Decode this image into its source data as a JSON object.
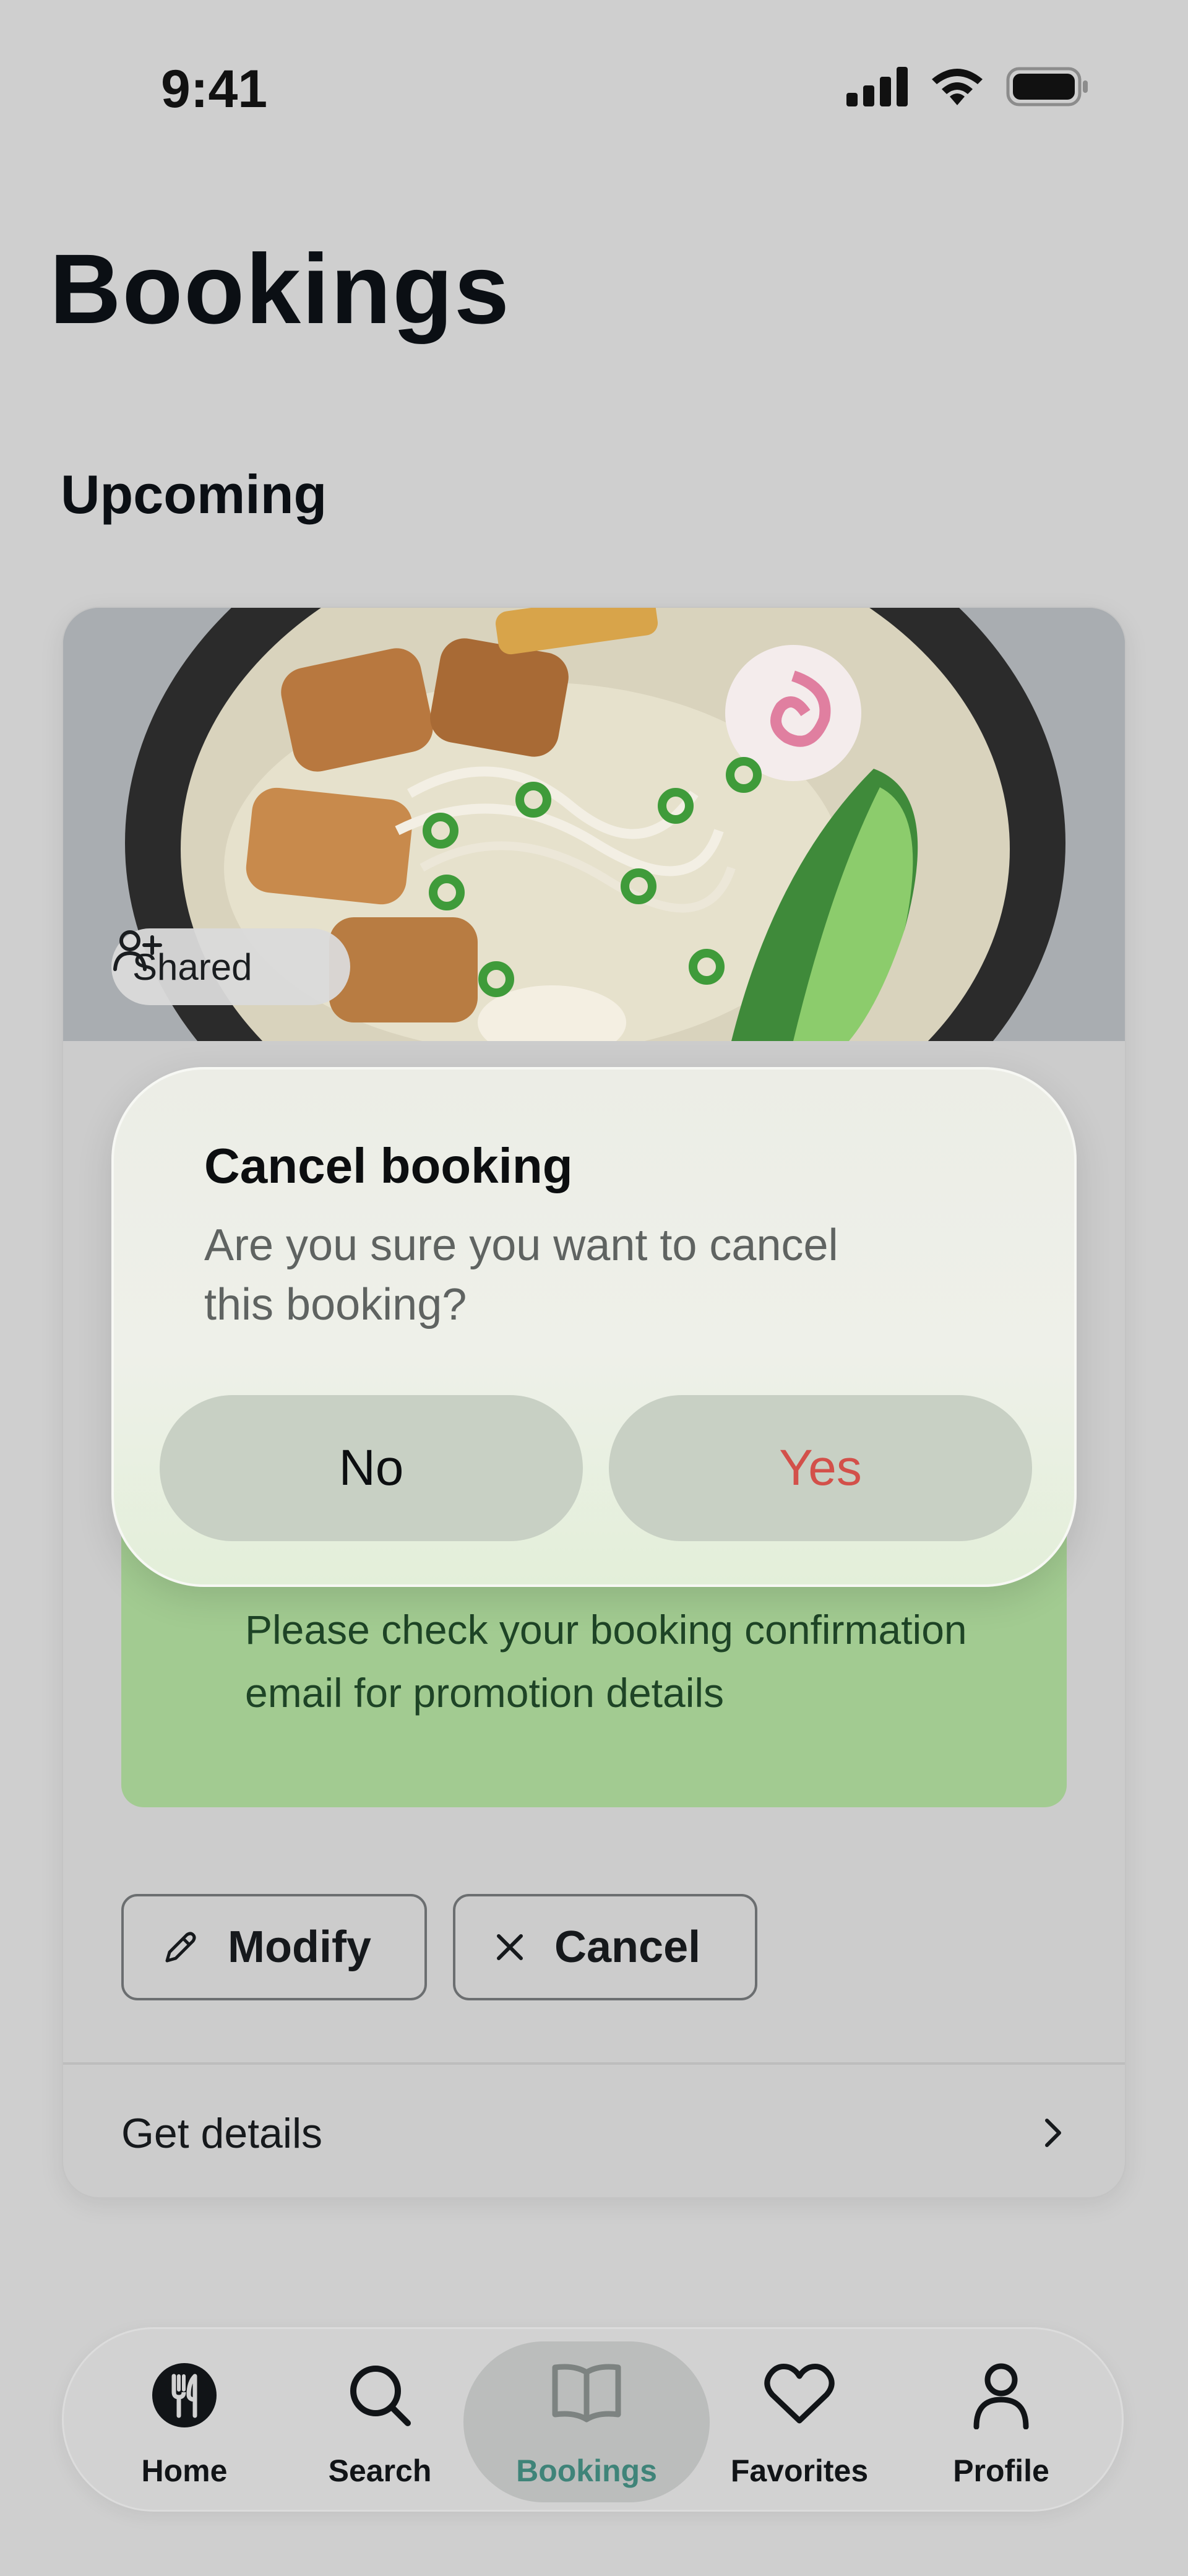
{
  "status_bar": {
    "time": "9:41"
  },
  "page": {
    "title": "Bookings",
    "section": "Upcoming"
  },
  "booking_card": {
    "shared_label": "Shared",
    "promo_text": "Please check your booking confirmation email for promotion details",
    "modify_label": "Modify",
    "cancel_label": "Cancel",
    "details_label": "Get details"
  },
  "dialog": {
    "title": "Cancel booking",
    "message": "Are you sure you want to cancel this booking?",
    "no_label": "No",
    "yes_label": "Yes"
  },
  "tab_bar": {
    "active": "Bookings",
    "items": [
      {
        "label": "Home",
        "icon": "fork-knife-icon"
      },
      {
        "label": "Search",
        "icon": "search-icon"
      },
      {
        "label": "Bookings",
        "icon": "book-icon"
      },
      {
        "label": "Favorites",
        "icon": "heart-icon"
      },
      {
        "label": "Profile",
        "icon": "person-icon"
      }
    ]
  },
  "colors": {
    "accent_active_tab": "#3f8479",
    "destructive": "#d3504a",
    "promo_bg": "#a2cb91"
  }
}
